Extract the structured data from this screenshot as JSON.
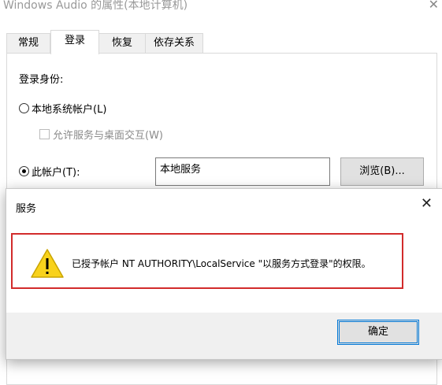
{
  "window": {
    "title": "Windows Audio 的属性(本地计算机)",
    "close_glyph": "✕"
  },
  "tabs": [
    {
      "label": "常规",
      "active": false
    },
    {
      "label": "登录",
      "active": true
    },
    {
      "label": "恢复",
      "active": false
    },
    {
      "label": "依存关系",
      "active": false
    }
  ],
  "logon": {
    "section_label": "登录身份:",
    "local_system_label": "本地系统帐户(L)",
    "local_system_selected": false,
    "allow_desktop_label": "允许服务与桌面交互(W)",
    "allow_desktop_checked": false,
    "this_account_label": "此帐户(T):",
    "this_account_selected": true,
    "account_value": "本地服务",
    "browse_label": "浏览(B)..."
  },
  "dialog": {
    "title": "服务",
    "close_glyph": "✕",
    "icon": "warning-icon",
    "message": "已授予帐户 NT AUTHORITY\\LocalService \"以服务方式登录\"的权限。",
    "ok_label": "确定"
  },
  "colors": {
    "highlight_border": "#d22b2b",
    "warning_fill": "#f8d21c",
    "focus_border": "#0078d7"
  }
}
